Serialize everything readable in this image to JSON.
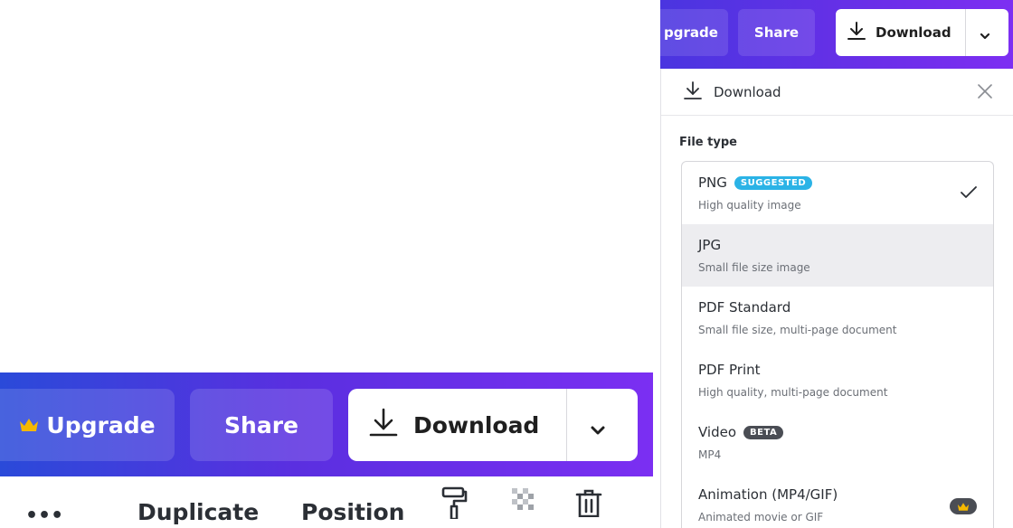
{
  "top_bar": {
    "upgrade_label": "pgrade",
    "share_label": "Share",
    "download_label": "Download"
  },
  "big_bar": {
    "upgrade_label": "Upgrade",
    "share_label": "Share",
    "download_label": "Download"
  },
  "toolbar2": {
    "more_label": "•••",
    "duplicate_label": "Duplicate",
    "position_label": "Position"
  },
  "panel": {
    "header_title": "Download",
    "file_type_label": "File type",
    "options": [
      {
        "title": "PNG",
        "badge": "SUGGESTED",
        "subtitle": "High quality image",
        "selected": true
      },
      {
        "title": "JPG",
        "subtitle": "Small file size image",
        "hover": true
      },
      {
        "title": "PDF Standard",
        "subtitle": "Small file size, multi-page document"
      },
      {
        "title": "PDF Print",
        "subtitle": "High quality, multi-page document"
      },
      {
        "title": "Video",
        "badge": "BETA",
        "subtitle": "MP4"
      },
      {
        "title": "Animation (MP4/GIF)",
        "subtitle": "Animated movie or GIF",
        "premium": true
      }
    ]
  },
  "colors": {
    "accent_gradient_start": "#2a4ad9",
    "accent_gradient_end": "#7b2ff2",
    "suggested_badge": "#2bb3e6",
    "crown": "#f5b800"
  },
  "icons": [
    "crown-icon",
    "download-icon",
    "chevron-down-icon",
    "close-icon",
    "check-icon",
    "paint-roller-icon",
    "transparency-icon",
    "trash-icon"
  ]
}
